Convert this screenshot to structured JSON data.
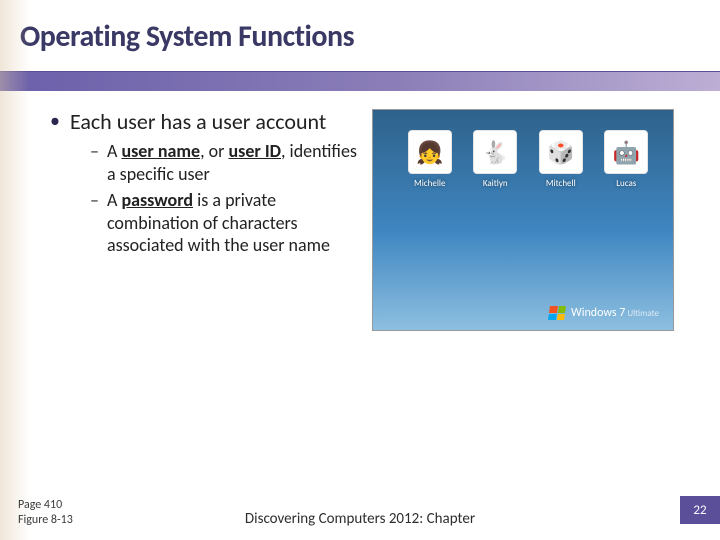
{
  "title": "Operating System Functions",
  "bullet": {
    "main": "Each user has a user account",
    "subs": [
      {
        "prefix": "A ",
        "bold1": "user name",
        "mid": ", or ",
        "bold2": "user ID",
        "rest": ", identifies a specific user"
      },
      {
        "prefix": "A ",
        "bold1": "password",
        "rest2": " is a private combination of characters associated with the user name"
      }
    ]
  },
  "login": {
    "users": [
      {
        "name": "Michelle",
        "emoji": "👧"
      },
      {
        "name": "Kaitlyn",
        "emoji": "🐇"
      },
      {
        "name": "Mitchell",
        "emoji": "🎲"
      },
      {
        "name": "Lucas",
        "emoji": "🤖"
      }
    ],
    "brand": "Windows 7",
    "edition": "Ultimate"
  },
  "footer": {
    "page_ref": "Page 410",
    "figure_ref": "Figure 8-13",
    "center": "Discovering Computers 2012: Chapter",
    "slide_no": "22"
  }
}
